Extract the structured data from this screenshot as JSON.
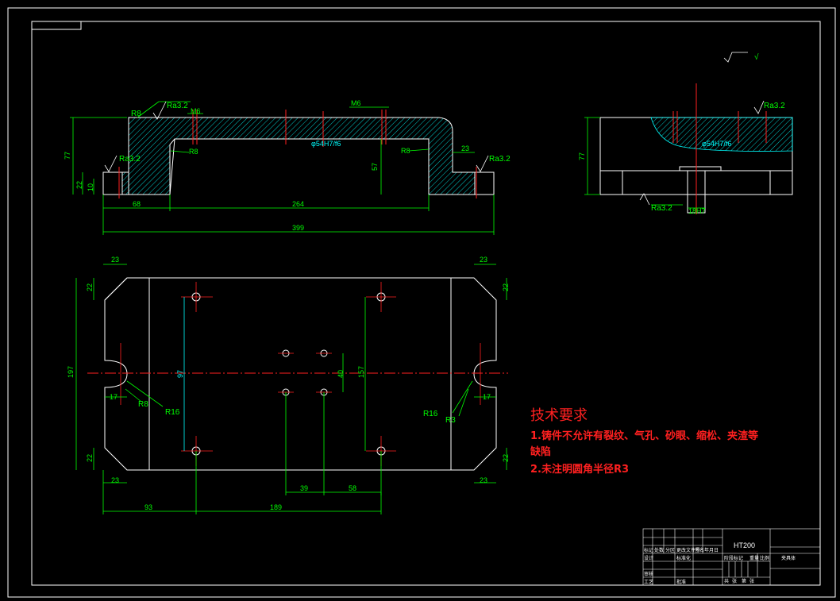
{
  "front_view": {
    "labels": {
      "r8_top": "R8",
      "ra_top": "Ra3.2",
      "m6_left": "M6",
      "m6_right": "M6",
      "phi_center": "φ54H7/f6",
      "r8_inner_left": "R8",
      "r8_inner_right": "R8",
      "ra_left": "Ra3.2",
      "ra_right": "Ra3.2"
    },
    "dims": {
      "h77": "77",
      "h22": "22",
      "h10": "10",
      "h57": "57",
      "w23": "23",
      "w68": "68",
      "w264": "264",
      "w399": "399"
    }
  },
  "side_view": {
    "roughness_note": "√",
    "ra_top": "Ra3.2",
    "phi": "φ54H7/f6",
    "ra_bottom": "Ra3.2",
    "slot": "18H7",
    "h77": "77"
  },
  "top_view": {
    "dims": {
      "c23_tl": "23",
      "c22_tl": "22",
      "c23_tr": "23",
      "c22_tr": "22",
      "h197": "197",
      "h97": "97",
      "h157": "157",
      "h40": "40",
      "s17_l": "17",
      "s17_r": "17",
      "c22_bl": "22",
      "c23_bl": "23",
      "c22_br": "22",
      "c23_br": "23",
      "w39": "39",
      "w58": "58",
      "w93": "93",
      "w189": "189"
    },
    "labels": {
      "r8_l": "R8",
      "r16_l": "R16",
      "r16_r": "R16",
      "r3_r": "R3"
    }
  },
  "tech_requirements": {
    "title": "技术要求",
    "line1a": "1.铸件不允许有裂纹、气孔、砂眼、缩松、夹渣等",
    "line1b": "缺陷",
    "line2": "2.未注明圆角半径R3"
  },
  "title_block": {
    "material": "HT200",
    "part_name": "夹具体",
    "cells": [
      "标记",
      "处数",
      "分区",
      "更改文件号",
      "签名",
      "年月日",
      "设计",
      "标准化",
      "阶段标记",
      "重量",
      "比例",
      "审核",
      "工艺",
      "批准",
      "共",
      "张",
      "第",
      "张"
    ]
  }
}
